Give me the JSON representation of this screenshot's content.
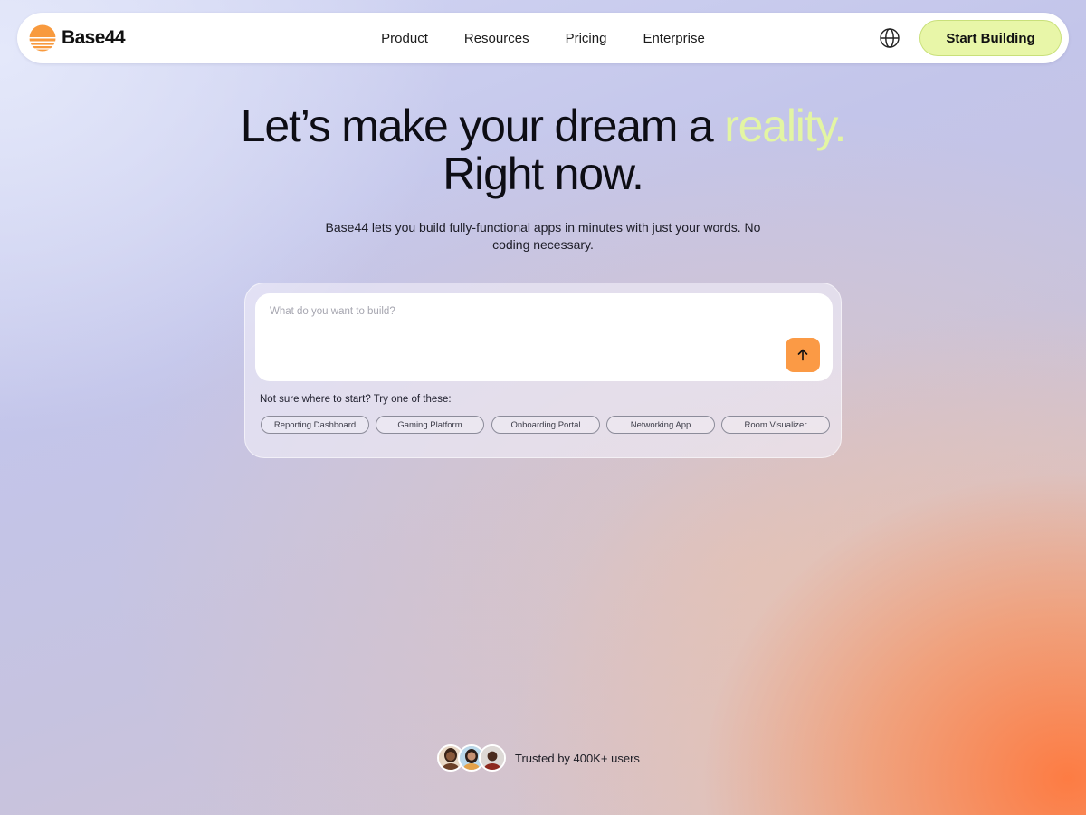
{
  "brand": {
    "name": "Base44",
    "logo_icon": "sunset-stripes-logo",
    "colors": {
      "logo_orange": "#f89a3e",
      "accent_green": "#e3f5a3",
      "cta_background": "#e8f6a8",
      "send_button": "#fb9a45"
    }
  },
  "nav": {
    "links": [
      "Product",
      "Resources",
      "Pricing",
      "Enterprise"
    ],
    "language_icon": "globe-icon",
    "cta_label": "Start Building"
  },
  "hero": {
    "title_part1": "Let’s make your dream a ",
    "title_accent": "reality.",
    "title_line2": "Right now.",
    "subtitle": "Base44 lets you build fully-functional apps in minutes with just your words. No coding necessary."
  },
  "prompt": {
    "placeholder": "What do you want to build?",
    "value": "",
    "send_icon": "arrow-up-icon",
    "hint": "Not sure where to start? Try one of these:",
    "suggestions": [
      "Reporting Dashboard",
      "Gaming Platform",
      "Onboarding Portal",
      "Networking App",
      "Room Visualizer"
    ]
  },
  "social_proof": {
    "text": "Trusted by 400K+ users",
    "avatars": [
      "user-avatar-1",
      "user-avatar-2",
      "user-avatar-3"
    ]
  }
}
